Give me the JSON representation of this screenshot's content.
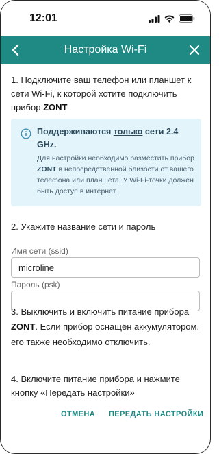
{
  "status_bar": {
    "time": "12:01"
  },
  "app_bar": {
    "title": "Настройка Wi-Fi"
  },
  "step1": {
    "text": "1. Подключите ваш телефон или планшет к сети Wi-Fi, к которой хотите подключить прибор ",
    "brand": "ZONT"
  },
  "info": {
    "head_before": "Поддерживаются ",
    "head_underlined": "только",
    "head_after": " сети 2.4 GHz.",
    "body_before": "Для настройки необходимо разместить прибор ",
    "body_brand": "ZONT",
    "body_after": " в непосредственной близости от вашего телефона или планшета. У Wi-Fi-точки должен быть доступ в интернет."
  },
  "step2": {
    "text": "2. Укажите название сети и пароль"
  },
  "form": {
    "ssid_label": "Имя сети (ssid)",
    "ssid_value": "microline",
    "psk_label": "Пароль (psk)",
    "psk_value": ""
  },
  "step3": {
    "before": "3. Выключить и включить питание прибора ",
    "brand": "ZONT",
    "after": ". Если прибор оснащён аккумулятором, его также необходимо отключить."
  },
  "step4": {
    "text": "4. Включите питание прибора и нажмите кнопку «Передать настройки»"
  },
  "actions": {
    "cancel": "ОТМЕНА",
    "submit": "ПЕРЕДАТЬ НАСТРОЙКИ"
  },
  "colors": {
    "accent": "#1f8a83",
    "info_bg": "#e4f4fb"
  }
}
